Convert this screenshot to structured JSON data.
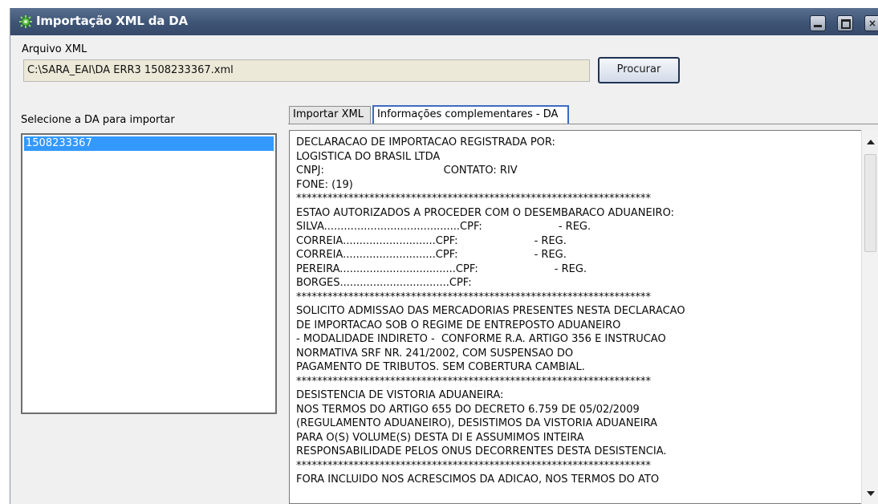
{
  "window": {
    "title": "Importação XML da DA",
    "controls": {
      "minimize": "minimize-icon",
      "maximize": "maximize-icon",
      "close": "×"
    }
  },
  "file": {
    "label": "Arquivo XML",
    "path": "C:\\SARA_EAI\\DA ERR3 1508233367.xml",
    "browse_label": "Procurar"
  },
  "da_list": {
    "label": "Selecione a DA para importar",
    "items": [
      "1508233367"
    ],
    "selected_index": 0
  },
  "tabs": [
    {
      "label": "Importar XML",
      "active": false
    },
    {
      "label": "Informações complementares - DA",
      "active": true
    }
  ],
  "info_text": [
    "DECLARACAO DE IMPORTACAO REGISTRADA POR:",
    "LOGISTICA DO BRASIL LTDA",
    "CNPJ:                                    CONTATO: RIV",
    "FONE: (19)",
    "********************************************************************",
    "ESTAO AUTORIZADOS A PROCEDER COM O DESEMBARACO ADUANEIRO:",
    "SILVA.........................................CPF:                       - REG.",
    "CORREIA............................CPF:                       - REG.",
    "CORREIA............................CPF:                       - REG.",
    "PEREIRA...................................CPF:                       - REG.",
    "BORGES.................................CPF:",
    "********************************************************************",
    "SOLICITO ADMISSAO DAS MERCADORIAS PRESENTES NESTA DECLARACAO",
    "DE IMPORTACAO SOB O REGIME DE ENTREPOSTO ADUANEIRO",
    "- MODALIDADE INDIRETO -  CONFORME R.A. ARTIGO 356 E INSTRUCAO",
    "NORMATIVA SRF NR. 241/2002, COM SUSPENSAO DO",
    "PAGAMENTO DE TRIBUTOS. SEM COBERTURA CAMBIAL.",
    "********************************************************************",
    "DESISTENCIA DE VISTORIA ADUANEIRA:",
    "NOS TERMOS DO ARTIGO 655 DO DECRETO 6.759 DE 05/02/2009",
    "(REGULAMENTO ADUANEIRO), DESISTIMOS DA VISTORIA ADUANEIRA",
    "PARA O(S) VOLUME(S) DESTA DI E ASSUMIMOS INTEIRA",
    "RESPONSABILIDADE PELOS ONUS DECORRENTES DESTA DESISTENCIA.",
    "********************************************************************",
    "FORA INCLUIDO NOS ACRESCIMOS DA ADICAO, NOS TERMOS DO ATO"
  ],
  "colors": {
    "titlebar": "#3f5576",
    "selection": "#3399ff",
    "active_tab_border": "#3a6cc4"
  }
}
